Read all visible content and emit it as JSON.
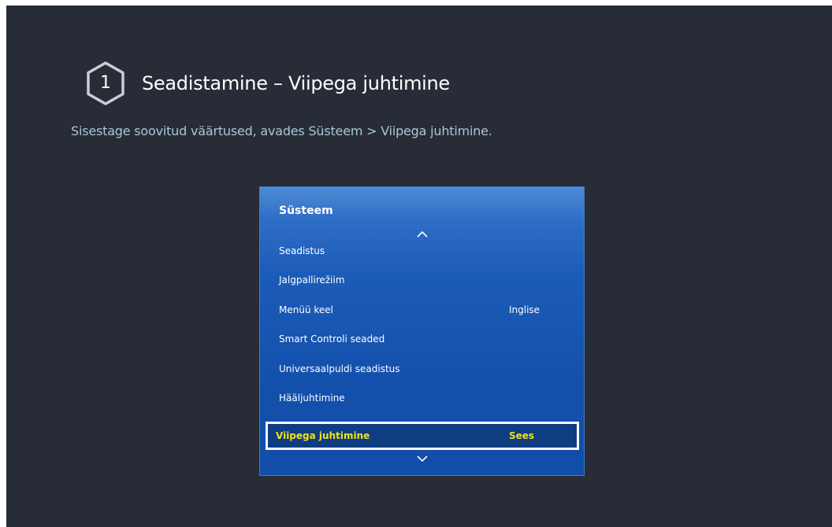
{
  "step": {
    "number": "1",
    "title": "Seadistamine – Viipega juhtimine"
  },
  "instruction": "Sisestage soovitud väärtused, avades Süsteem > Viipega juhtimine.",
  "menu": {
    "title": "Süsteem",
    "scroll_up_icon": "chevron-up-icon",
    "scroll_down_icon": "chevron-down-icon",
    "items": [
      {
        "label": "Seadistus",
        "value": ""
      },
      {
        "label": "Jalgpallirežiim",
        "value": ""
      },
      {
        "label": "Menüü keel",
        "value": "Inglise"
      },
      {
        "label": "Smart Controli seaded",
        "value": ""
      },
      {
        "label": "Universaalpuldi seadistus",
        "value": ""
      },
      {
        "label": "Hääljuhtimine",
        "value": ""
      },
      {
        "label": "Viipega juhtimine",
        "value": "Sees",
        "selected": true
      }
    ]
  },
  "colors": {
    "background": "#272c36",
    "menu_blue": "#1c5cb9",
    "selected_bg": "#103d80",
    "selected_text": "#f0e21c",
    "instruction_text": "#a9c6d8"
  }
}
